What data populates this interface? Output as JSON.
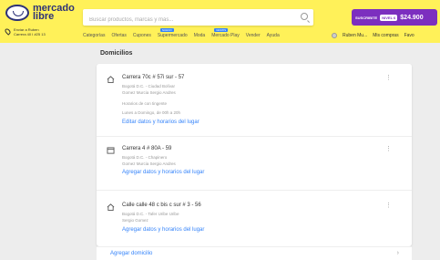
{
  "header": {
    "logo_line1": "mercado",
    "logo_line2": "libre",
    "search_placeholder": "Buscar productos, marcas y más...",
    "promo": {
      "text": "SUSCRIBITE",
      "level": "NIVEL 6",
      "price": "$24.900"
    },
    "location": {
      "line1": "Enviar a Ruben",
      "line2": "Carrera 40 I #25 13"
    },
    "nav": [
      "Categorías",
      "Ofertas",
      "Cupones",
      "Supermercado",
      "Moda",
      "Mercado Play",
      "Vender",
      "Ayuda"
    ],
    "nav_badges": {
      "supermercado": "NUEVO",
      "mercado_play": "GRATIS"
    },
    "user_nav": {
      "account": "Ruben Mu...",
      "purchases": "Mis compras",
      "favorites": "Favo"
    }
  },
  "page": {
    "title": "Domicilios"
  },
  "addresses": [
    {
      "title": "Carrera 70c # 57i sur - 57",
      "lines": [
        "Bogotá D.C. - Ciudad Bolívar",
        "Gomez Murcia Sergio Andres"
      ],
      "extra_lines": [
        "Horarios de con tingente",
        "Lunes a Domingo, de 00h a 20h"
      ],
      "link": "Editar datos y horarios del lugar"
    },
    {
      "title": "Carrera 4 # 80A - 59",
      "lines": [
        "Bogotá D.C. - Chapinero",
        "Gomez Murcia Sergio Andres"
      ],
      "link": "Agregar datos y horarios del lugar"
    },
    {
      "title": "Calle calle 48 c bis c sur # 3 - 56",
      "lines": [
        "Bogotá D.C. - Tafer Uribe Uribe",
        "Sergio Gomez"
      ],
      "link": "Agregar datos y horarios del lugar"
    }
  ],
  "add_address": {
    "label": "Agregar domicilio"
  },
  "colors": {
    "header_bg": "#fff159",
    "link": "#3483fa",
    "promo": "#7c2fbf",
    "brand": "#2d3277"
  }
}
